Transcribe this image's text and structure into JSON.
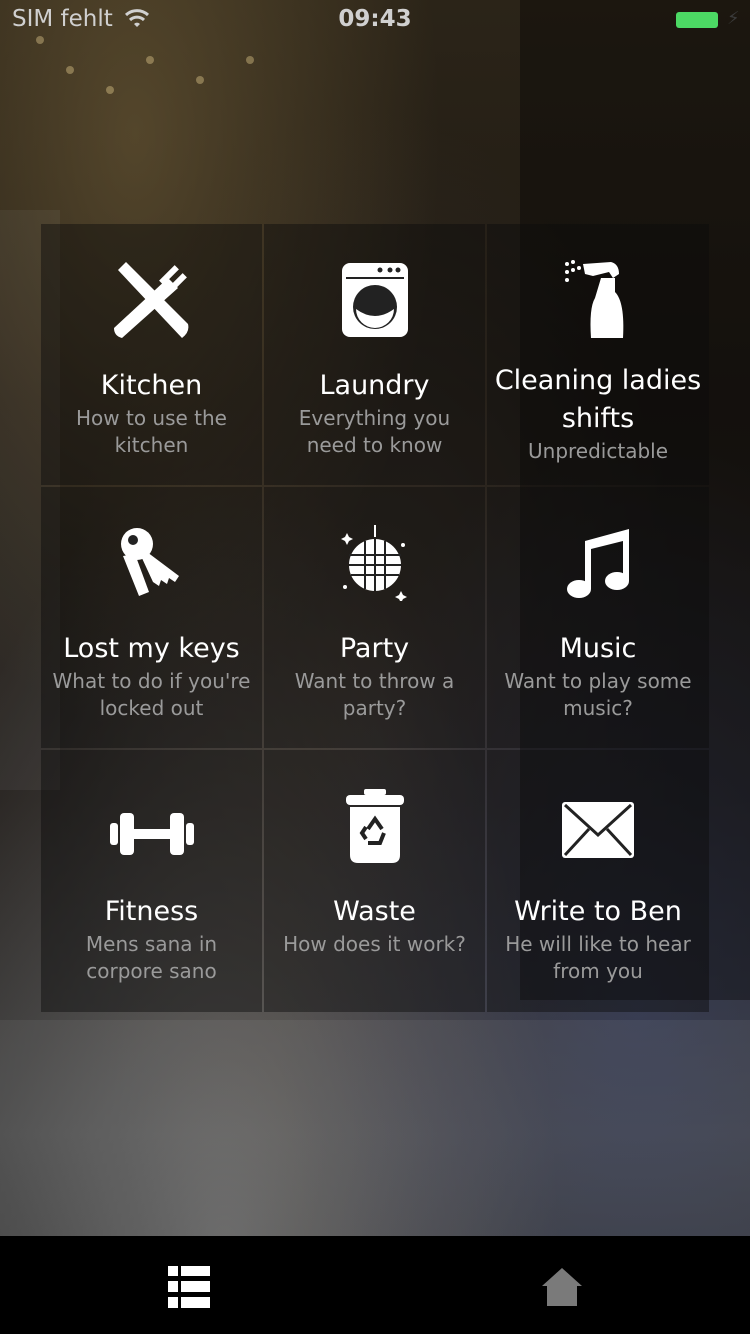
{
  "status": {
    "carrier": "SIM fehlt",
    "time": "09:43",
    "battery_color": "#4cd964"
  },
  "tiles": [
    {
      "title": "Kitchen",
      "subtitle": "How to use the kitchen",
      "icon": "fork-knife-icon"
    },
    {
      "title": "Laundry",
      "subtitle": "Everything you need to know",
      "icon": "washing-machine-icon"
    },
    {
      "title": "Cleaning ladies shifts",
      "subtitle": "Unpredictable",
      "icon": "spray-bottle-icon"
    },
    {
      "title": "Lost my keys",
      "subtitle": "What to do if you're locked out",
      "icon": "keys-icon"
    },
    {
      "title": "Party",
      "subtitle": "Want to throw a party?",
      "icon": "disco-ball-icon"
    },
    {
      "title": "Music",
      "subtitle": "Want to play some music?",
      "icon": "music-note-icon"
    },
    {
      "title": "Fitness",
      "subtitle": "Mens sana in corpore sano",
      "icon": "dumbbell-icon"
    },
    {
      "title": "Waste",
      "subtitle": "How does it work?",
      "icon": "recycle-bin-icon"
    },
    {
      "title": "Write to Ben",
      "subtitle": "He will like to hear from you",
      "icon": "envelope-icon"
    }
  ],
  "tab_bar": {
    "items": [
      {
        "icon": "list-icon",
        "active": true
      },
      {
        "icon": "home-icon",
        "active": false
      }
    ]
  }
}
